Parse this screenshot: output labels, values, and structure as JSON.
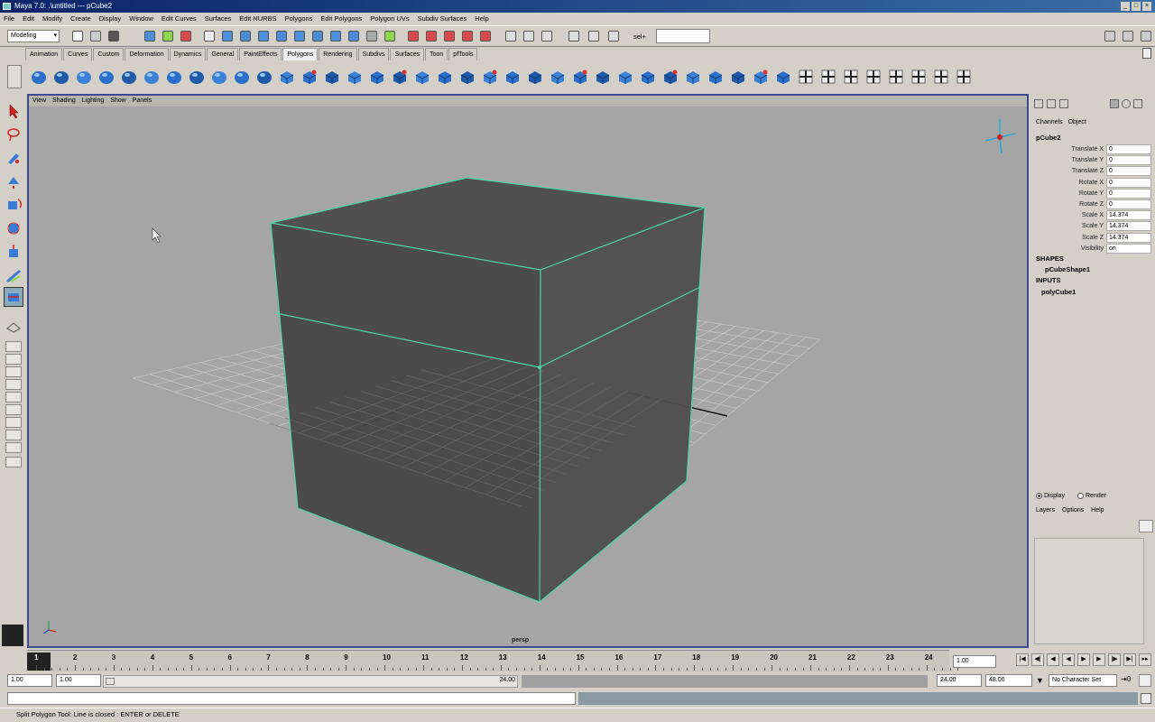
{
  "window": {
    "title": "Maya 7.0: .\\untitled  ---  pCube2",
    "min": "_",
    "max": "□",
    "close": "×"
  },
  "menus": [
    "File",
    "Edit",
    "Modify",
    "Create",
    "Display",
    "Window",
    "Edit Curves",
    "Surfaces",
    "Edit NURBS",
    "Polygons",
    "Edit Polygons",
    "Polygon UVs",
    "Subdiv Surfaces",
    "Help"
  ],
  "statusline": {
    "mode": "Modeling",
    "sel_label": "sel+",
    "sel_value": ""
  },
  "shelf_tabs": [
    "Animation",
    "Curves",
    "Custom",
    "Deformation",
    "Dynamics",
    "General",
    "PaintEffects",
    "Polygons",
    "Rendering",
    "Subdivs",
    "Surfaces",
    "Toon",
    "pfTools"
  ],
  "active_shelf": "Polygons",
  "viewport": {
    "menus": [
      "View",
      "Shading",
      "Lighting",
      "Show",
      "Panels"
    ],
    "camera_label": "persp"
  },
  "channel_box": {
    "tabs": [
      "Channels",
      "Object"
    ],
    "object_name": "pCube2",
    "attributes": [
      {
        "label": "Translate X",
        "value": "0"
      },
      {
        "label": "Translate Y",
        "value": "0"
      },
      {
        "label": "Translate Z",
        "value": "0"
      },
      {
        "label": "Rotate X",
        "value": "0"
      },
      {
        "label": "Rotate Y",
        "value": "0"
      },
      {
        "label": "Rotate Z",
        "value": "0"
      },
      {
        "label": "Scale X",
        "value": "14.374"
      },
      {
        "label": "Scale Y",
        "value": "14.374"
      },
      {
        "label": "Scale Z",
        "value": "14.374"
      },
      {
        "label": "Visibility",
        "value": "on"
      }
    ],
    "shapes_header": "SHAPES",
    "shape_name": "pCubeShape1",
    "inputs_header": "INPUTS",
    "input_name": "polyCube1"
  },
  "layer_editor": {
    "display_label": "Display",
    "render_label": "Render",
    "menus": [
      "Layers",
      "Options",
      "Help"
    ]
  },
  "time_slider": {
    "ticks": [
      "1",
      "2",
      "3",
      "4",
      "5",
      "6",
      "7",
      "8",
      "9",
      "10",
      "11",
      "12",
      "13",
      "14",
      "15",
      "16",
      "17",
      "18",
      "19",
      "20",
      "21",
      "22",
      "23",
      "24"
    ],
    "current_frame": "1.00"
  },
  "range_slider": {
    "start": "1.00",
    "playback_start": "1.00",
    "range_end_handle": "24.00",
    "playback_end": "24.00",
    "end": "48.00",
    "character_set": "No Character Set"
  },
  "help_line": "Split Polygon Tool: Line is closed : ENTER or DELETE",
  "colors": {
    "viewport_bg": "#a5a5a5",
    "cube_face": "#4a4a4a",
    "edge_highlight": "#4fd6a5",
    "grid": "#c8c8c8"
  }
}
